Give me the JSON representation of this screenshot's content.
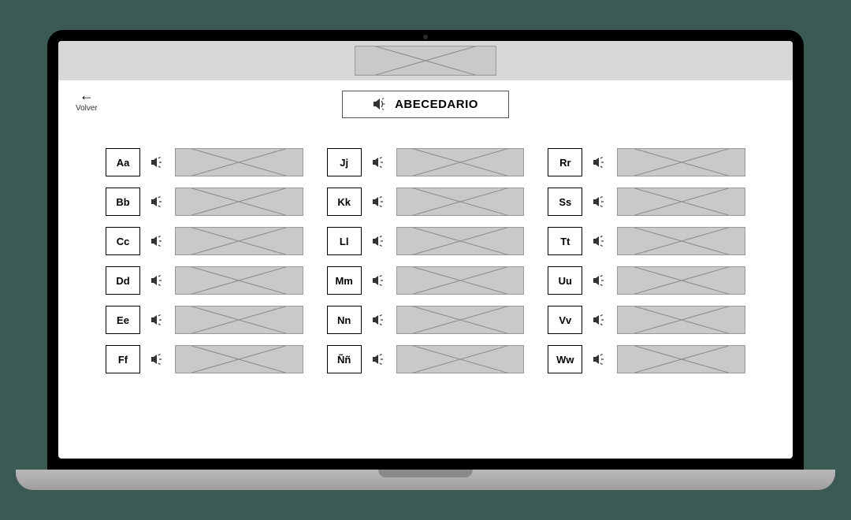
{
  "header": {
    "back_label": "Volver",
    "title": "ABECEDARIO"
  },
  "columns": [
    {
      "letters": [
        "Aa",
        "Bb",
        "Cc",
        "Dd",
        "Ee",
        "Ff"
      ]
    },
    {
      "letters": [
        "Jj",
        "Kk",
        "Ll",
        "Mm",
        "Nn",
        "Ññ"
      ]
    },
    {
      "letters": [
        "Rr",
        "Ss",
        "Tt",
        "Uu",
        "Vv",
        "Ww"
      ]
    }
  ]
}
